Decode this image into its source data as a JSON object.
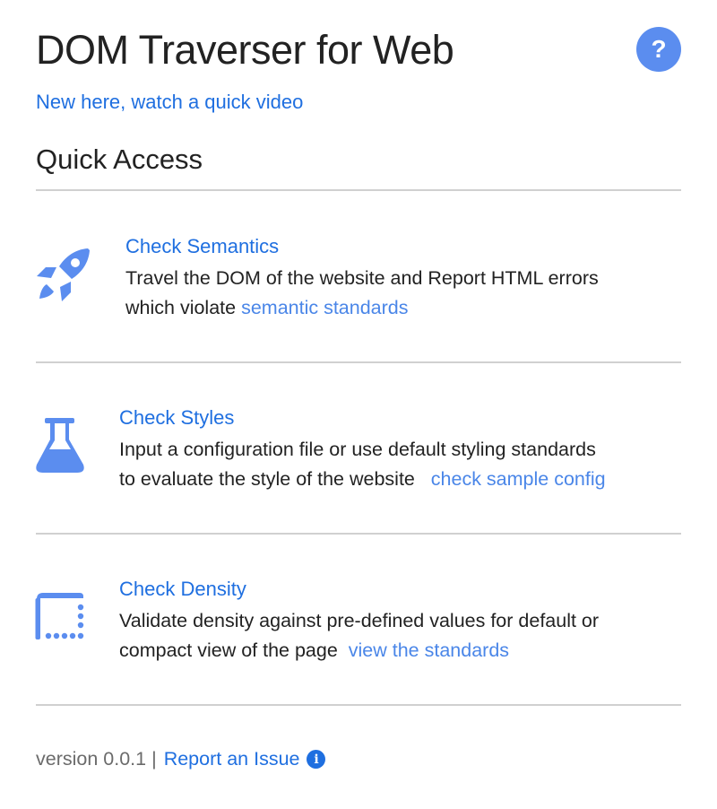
{
  "header": {
    "title": "DOM Traverser for Web",
    "help_label": "?",
    "video_link": "New here, watch a quick video"
  },
  "quick_access": {
    "title": "Quick Access",
    "items": [
      {
        "icon": "rocket-icon",
        "title": "Check Semantics",
        "desc_line1": "Travel the DOM of the website and Report HTML errors",
        "desc_line2": "which violate",
        "link": "semantic standards"
      },
      {
        "icon": "flask-icon",
        "title": "Check Styles",
        "desc_line1": "Input a configuration file or use default styling standards",
        "desc_line2": "to evaluate the style of the website",
        "link": "check sample config"
      },
      {
        "icon": "density-icon",
        "title": "Check Density",
        "desc_line1": "Validate density against pre-defined values for default or",
        "desc_line2": "compact view of the page",
        "link": "view the standards"
      }
    ]
  },
  "footer": {
    "version": "version 0.0.1",
    "separator": "|",
    "issue_link": "Report an Issue",
    "info_glyph": "i"
  },
  "colors": {
    "accent": "#1f6fe0",
    "icon": "#5b8def",
    "divider": "#d0d0d0"
  }
}
